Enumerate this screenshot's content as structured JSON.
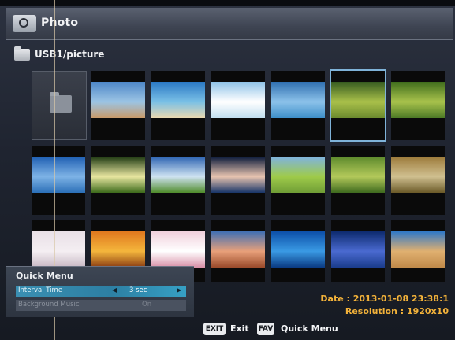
{
  "window": {
    "title": "Photo"
  },
  "path": {
    "text": "USB1/picture"
  },
  "thumbnails": [
    {
      "name": "beach-sunset",
      "colors": [
        "#4d87c8",
        "#9cc4e4",
        "#c89a6a"
      ]
    },
    {
      "name": "tropical-beach",
      "colors": [
        "#2a78c4",
        "#7ac0e6",
        "#e9d8b0"
      ]
    },
    {
      "name": "snow-house",
      "colors": [
        "#8fc3e8",
        "#ffffff",
        "#c2dff0"
      ]
    },
    {
      "name": "ocean-horizon",
      "colors": [
        "#2f6fb0",
        "#8cc2ea",
        "#3e8fc9"
      ]
    },
    {
      "name": "forest-path",
      "colors": [
        "#365b20",
        "#a9c04a",
        "#6b8a2e"
      ]
    },
    {
      "name": "green-field",
      "colors": [
        "#3f6d1c",
        "#a8c24c",
        "#4d7a26"
      ]
    },
    {
      "name": "blue-sky-sea",
      "colors": [
        "#1f5fb2",
        "#7eb3e6",
        "#2b6fb7"
      ]
    },
    {
      "name": "tree-sunrise",
      "colors": [
        "#1f3a12",
        "#e8e6a0",
        "#3c6a1a"
      ]
    },
    {
      "name": "mountain-lake",
      "colors": [
        "#2d63b2",
        "#cfe3f2",
        "#4f8c2a"
      ]
    },
    {
      "name": "woman-portrait",
      "colors": [
        "#0b1a3a",
        "#e8c4b0",
        "#173468"
      ]
    },
    {
      "name": "meadow",
      "colors": [
        "#7fb3e0",
        "#9fcb4a",
        "#6f9d36"
      ]
    },
    {
      "name": "tree-lined-road",
      "colors": [
        "#5d8a2c",
        "#b3c95a",
        "#3e6a1e"
      ]
    },
    {
      "name": "autumn-trees",
      "colors": [
        "#9c7a3a",
        "#d0c090",
        "#6b5a28"
      ]
    },
    {
      "name": "white-cat",
      "colors": [
        "#e8e0e6",
        "#f4eef2",
        "#c8b8c4"
      ]
    },
    {
      "name": "sunset-glow",
      "colors": [
        "#e0781e",
        "#f4b63c",
        "#8a3c12"
      ]
    },
    {
      "name": "pink-flowers",
      "colors": [
        "#f0d0dc",
        "#ffffff",
        "#d890a8"
      ]
    },
    {
      "name": "rock-canyon",
      "colors": [
        "#3f6fb4",
        "#e8a07a",
        "#9a4a2a"
      ]
    },
    {
      "name": "underwater",
      "colors": [
        "#0c4fa8",
        "#3a9ae4",
        "#0a3a82"
      ]
    },
    {
      "name": "sports-car",
      "colors": [
        "#0d2a6e",
        "#4a6ad0",
        "#1a3c8c"
      ]
    },
    {
      "name": "desert-dunes",
      "colors": [
        "#2e78c8",
        "#e0b070",
        "#c08a4a"
      ]
    }
  ],
  "quick_menu": {
    "title": "Quick Menu",
    "rows": [
      {
        "label": "Interval Time",
        "value": "3 sec"
      },
      {
        "label": "Background Music",
        "value": "On"
      }
    ]
  },
  "info": {
    "date": "Date : 2013-01-08 23:38:1",
    "resolution": "Resolution : 1920x10"
  },
  "footer": {
    "exit_key": "EXIT",
    "exit_label": "Exit",
    "fav_key": "FAV",
    "fav_label": "Quick Menu"
  }
}
